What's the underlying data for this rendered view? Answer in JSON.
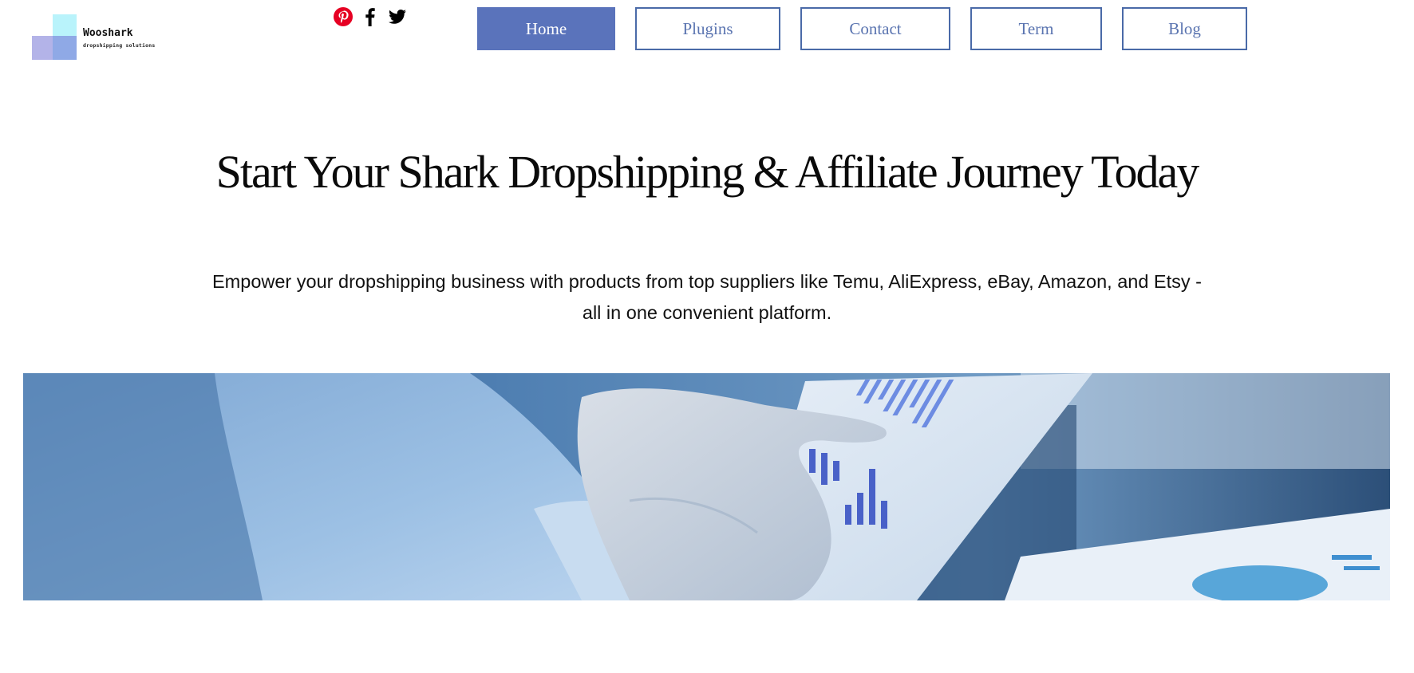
{
  "brand": {
    "name": "Wooshark",
    "tagline": "dropshipping solutions"
  },
  "social": [
    {
      "icon": "pinterest-icon",
      "color": "#e60023"
    },
    {
      "icon": "facebook-icon",
      "color": "#000000"
    },
    {
      "icon": "twitter-icon",
      "color": "#000000"
    }
  ],
  "nav": {
    "active": "Home",
    "items": [
      "Home",
      "Plugins",
      "Contact",
      "Term",
      "Blog"
    ]
  },
  "hero": {
    "headline": "Start Your Shark Dropshipping & Affiliate Journey Today",
    "subheadline": "Empower your dropshipping business with products from top suppliers like Temu, AliExpress, eBay, Amazon, and Etsy - all in one convenient platform.",
    "image": "business-analytics-tablet-photo"
  },
  "colors": {
    "accent": "#5a73bb",
    "nav_border": "#4a6aa8",
    "nav_text": "#5a74b0"
  }
}
